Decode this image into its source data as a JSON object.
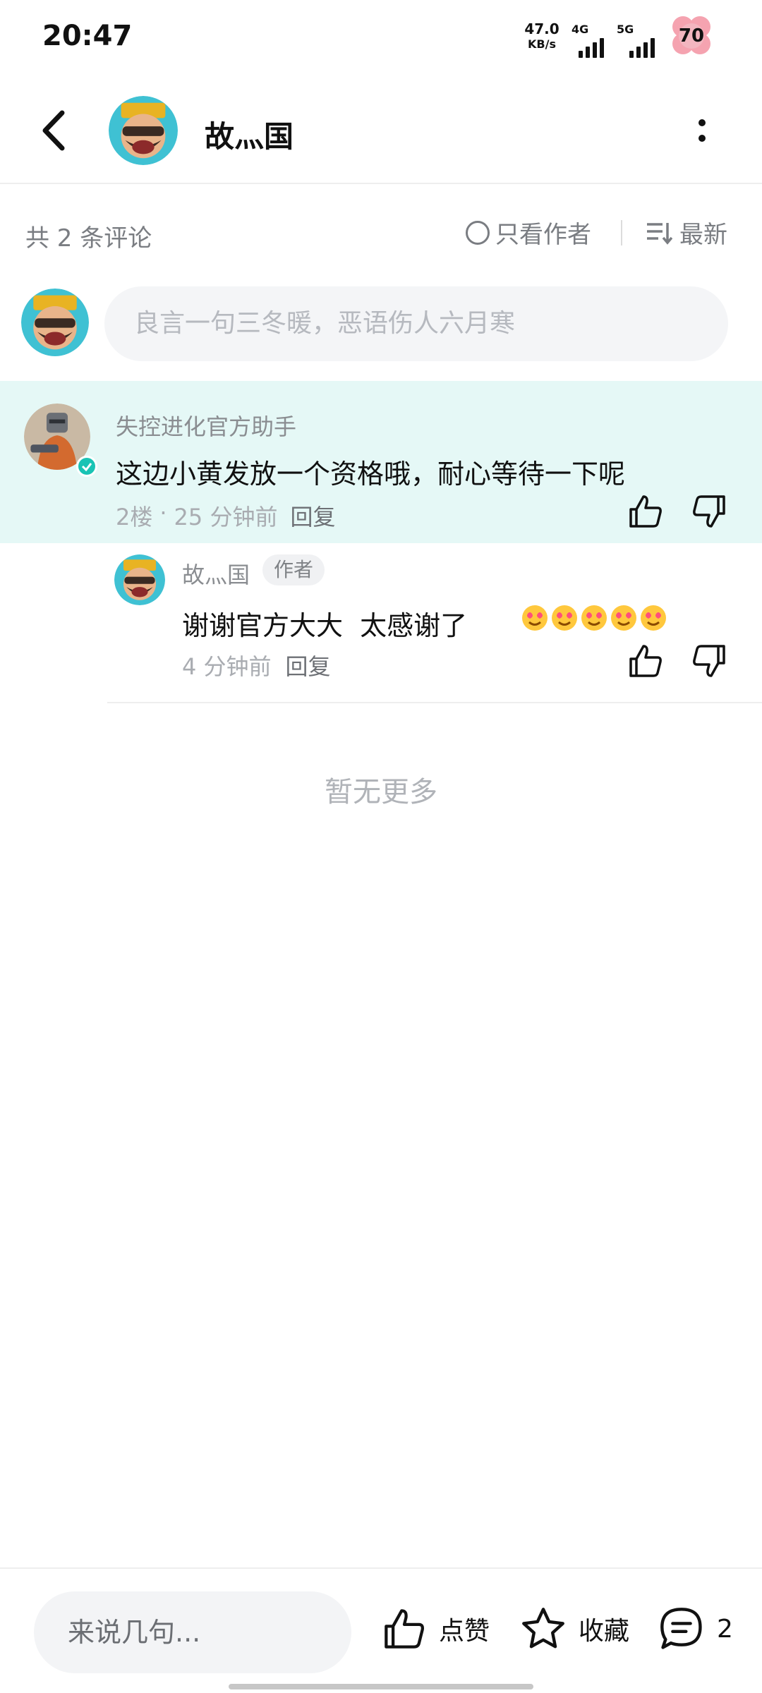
{
  "status_bar": {
    "time": "20:47",
    "net_speed_value": "47.0",
    "net_speed_unit": "KB/s",
    "signal_1_label": "4G",
    "signal_2_label": "5G",
    "battery": "70"
  },
  "header": {
    "title": "故灬国",
    "back_icon": "chevron-left-icon",
    "more_icon": "more-vertical-icon"
  },
  "toolbar": {
    "comment_count": "共 2 条评论",
    "author_only_label": "只看作者",
    "sort_label": "最新"
  },
  "comment_input": {
    "placeholder": "良言一句三冬暖，恶语伤人六月寒"
  },
  "comments": [
    {
      "author": "失控进化官方助手",
      "content": "这边小黄发放一个资格哦，耐心等待一下呢",
      "floor": "2楼",
      "dot": "·",
      "time": "25 分钟前",
      "reply_label": "回复",
      "verified": true
    },
    {
      "author": "故灬国",
      "author_badge": "作者",
      "content": "谢谢官方大大  太感谢了",
      "emoji_icons": [
        "heart-eyes-emoji-icon",
        "heart-eyes-emoji-icon",
        "heart-eyes-emoji-icon",
        "heart-eyes-emoji-icon",
        "heart-eyes-emoji-icon"
      ],
      "time": "4 分钟前",
      "reply_label": "回复"
    }
  ],
  "no_more": "暂无更多",
  "bottom_bar": {
    "input_placeholder": "来说几句...",
    "like_label": "点赞",
    "favorite_label": "收藏",
    "comment_count": "2"
  },
  "colors": {
    "highlight_bg": "#e5f8f6",
    "verified_badge": "#19c3b4",
    "muted_text": "#7a7d82"
  }
}
